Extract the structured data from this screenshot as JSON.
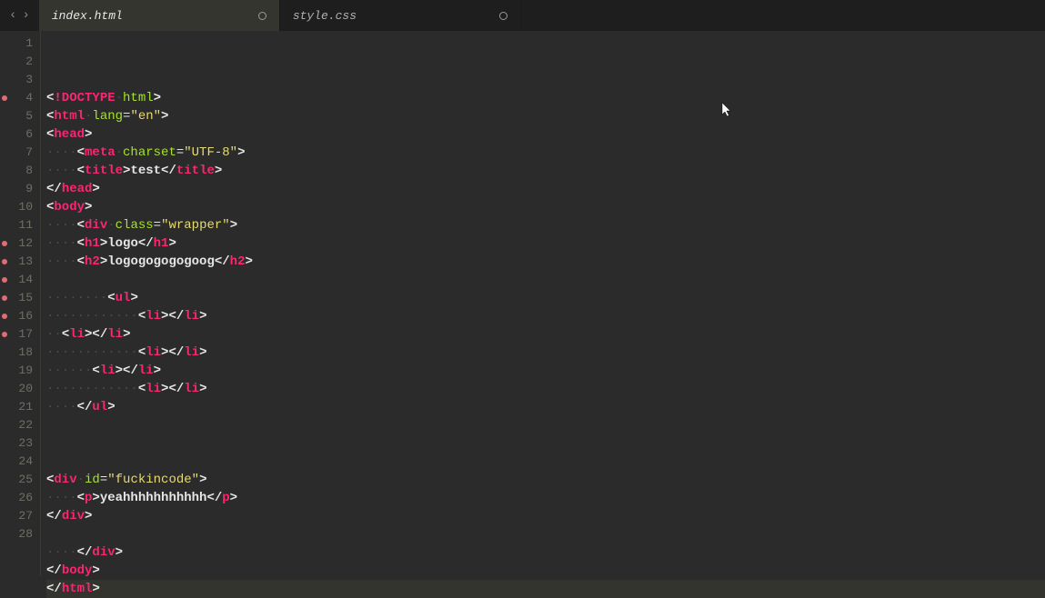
{
  "nav": {
    "back": "‹",
    "forward": "›"
  },
  "tabs": [
    {
      "name": "index.html",
      "active": true
    },
    {
      "name": "style.css",
      "active": false
    }
  ],
  "gutter": {
    "marks": [
      4,
      12,
      13,
      14,
      15,
      16,
      17
    ]
  },
  "code": [
    {
      "n": 1,
      "hl": false,
      "tokens": [
        [
          "punct",
          "<"
        ],
        [
          "doctype",
          "!DOCTYPE"
        ],
        [
          "ws",
          "·"
        ],
        [
          "attr",
          "html"
        ],
        [
          "punct",
          ">"
        ]
      ]
    },
    {
      "n": 2,
      "hl": false,
      "tokens": [
        [
          "punct",
          "<"
        ],
        [
          "tagname",
          "html"
        ],
        [
          "ws",
          "·"
        ],
        [
          "attr",
          "lang"
        ],
        [
          "op",
          "="
        ],
        [
          "str",
          "\"en\""
        ],
        [
          "punct",
          ">"
        ]
      ]
    },
    {
      "n": 3,
      "hl": false,
      "tokens": [
        [
          "punct",
          "<"
        ],
        [
          "tagname",
          "head"
        ],
        [
          "punct",
          ">"
        ]
      ]
    },
    {
      "n": 4,
      "hl": false,
      "tokens": [
        [
          "ws",
          "····"
        ],
        [
          "punct",
          "<"
        ],
        [
          "tagname",
          "meta"
        ],
        [
          "ws",
          "·"
        ],
        [
          "attr",
          "charset"
        ],
        [
          "op",
          "="
        ],
        [
          "str",
          "\"UTF-8\""
        ],
        [
          "punct",
          ">"
        ]
      ]
    },
    {
      "n": 5,
      "hl": false,
      "tokens": [
        [
          "ws",
          "····"
        ],
        [
          "punct",
          "<"
        ],
        [
          "tagname",
          "title"
        ],
        [
          "punct",
          ">"
        ],
        [
          "txt",
          "test"
        ],
        [
          "punct",
          "</"
        ],
        [
          "tagname",
          "title"
        ],
        [
          "punct",
          ">"
        ]
      ]
    },
    {
      "n": 6,
      "hl": false,
      "tokens": [
        [
          "punct",
          "</"
        ],
        [
          "tagname",
          "head"
        ],
        [
          "punct",
          ">"
        ]
      ]
    },
    {
      "n": 7,
      "hl": false,
      "tokens": [
        [
          "punct",
          "<"
        ],
        [
          "tagname",
          "body"
        ],
        [
          "punct",
          ">"
        ]
      ]
    },
    {
      "n": 8,
      "hl": false,
      "tokens": [
        [
          "ws",
          "····"
        ],
        [
          "punct",
          "<"
        ],
        [
          "tagname",
          "div"
        ],
        [
          "ws",
          "·"
        ],
        [
          "attr",
          "class"
        ],
        [
          "op",
          "="
        ],
        [
          "str",
          "\"wrapper\""
        ],
        [
          "punct",
          ">"
        ]
      ]
    },
    {
      "n": 9,
      "hl": false,
      "tokens": [
        [
          "ws",
          "····"
        ],
        [
          "punct",
          "<"
        ],
        [
          "tagname",
          "h1"
        ],
        [
          "punct",
          ">"
        ],
        [
          "txt",
          "logo"
        ],
        [
          "punct",
          "</"
        ],
        [
          "tagname",
          "h1"
        ],
        [
          "punct",
          ">"
        ]
      ]
    },
    {
      "n": 10,
      "hl": false,
      "tokens": [
        [
          "ws",
          "····"
        ],
        [
          "punct",
          "<"
        ],
        [
          "tagname",
          "h2"
        ],
        [
          "punct",
          ">"
        ],
        [
          "txt",
          "logogogogogoog"
        ],
        [
          "punct",
          "</"
        ],
        [
          "tagname",
          "h2"
        ],
        [
          "punct",
          ">"
        ]
      ]
    },
    {
      "n": 11,
      "hl": false,
      "tokens": []
    },
    {
      "n": 12,
      "hl": false,
      "tokens": [
        [
          "ws",
          "········"
        ],
        [
          "punct",
          "<"
        ],
        [
          "tagname",
          "ul"
        ],
        [
          "punct",
          ">"
        ]
      ]
    },
    {
      "n": 13,
      "hl": false,
      "tokens": [
        [
          "ws",
          "············"
        ],
        [
          "punct",
          "<"
        ],
        [
          "tagname",
          "li"
        ],
        [
          "punct",
          "></"
        ],
        [
          "tagname",
          "li"
        ],
        [
          "punct",
          ">"
        ]
      ]
    },
    {
      "n": 14,
      "hl": false,
      "tokens": [
        [
          "ws",
          "··"
        ],
        [
          "punct",
          "<"
        ],
        [
          "tagname",
          "li"
        ],
        [
          "punct",
          "></"
        ],
        [
          "tagname",
          "li"
        ],
        [
          "punct",
          ">"
        ]
      ]
    },
    {
      "n": 15,
      "hl": false,
      "tokens": [
        [
          "ws",
          "············"
        ],
        [
          "punct",
          "<"
        ],
        [
          "tagname",
          "li"
        ],
        [
          "punct",
          "></"
        ],
        [
          "tagname",
          "li"
        ],
        [
          "punct",
          ">"
        ]
      ]
    },
    {
      "n": 16,
      "hl": false,
      "tokens": [
        [
          "ws",
          "······"
        ],
        [
          "punct",
          "<"
        ],
        [
          "tagname",
          "li"
        ],
        [
          "punct",
          "></"
        ],
        [
          "tagname",
          "li"
        ],
        [
          "punct",
          ">"
        ]
      ]
    },
    {
      "n": 17,
      "hl": false,
      "tokens": [
        [
          "ws",
          "············"
        ],
        [
          "punct",
          "<"
        ],
        [
          "tagname",
          "li"
        ],
        [
          "punct",
          "></"
        ],
        [
          "tagname",
          "li"
        ],
        [
          "punct",
          ">"
        ]
      ]
    },
    {
      "n": 18,
      "hl": false,
      "tokens": [
        [
          "ws",
          "····"
        ],
        [
          "punct",
          "</"
        ],
        [
          "tagname",
          "ul"
        ],
        [
          "punct",
          ">"
        ]
      ]
    },
    {
      "n": 19,
      "hl": false,
      "tokens": []
    },
    {
      "n": 20,
      "hl": false,
      "tokens": []
    },
    {
      "n": 21,
      "hl": false,
      "tokens": []
    },
    {
      "n": 22,
      "hl": false,
      "tokens": [
        [
          "punct",
          "<"
        ],
        [
          "tagname",
          "div"
        ],
        [
          "ws",
          "·"
        ],
        [
          "attr",
          "id"
        ],
        [
          "op",
          "="
        ],
        [
          "str",
          "\"fuckincode\""
        ],
        [
          "punct",
          ">"
        ]
      ]
    },
    {
      "n": 23,
      "hl": false,
      "tokens": [
        [
          "ws",
          "····"
        ],
        [
          "punct",
          "<"
        ],
        [
          "tagname",
          "p"
        ],
        [
          "punct",
          ">"
        ],
        [
          "txt",
          "yeahhhhhhhhhhh"
        ],
        [
          "punct",
          "</"
        ],
        [
          "tagname",
          "p"
        ],
        [
          "punct",
          ">"
        ]
      ]
    },
    {
      "n": 24,
      "hl": false,
      "tokens": [
        [
          "punct",
          "</"
        ],
        [
          "tagname",
          "div"
        ],
        [
          "punct",
          ">"
        ]
      ]
    },
    {
      "n": 25,
      "hl": false,
      "tokens": []
    },
    {
      "n": 26,
      "hl": false,
      "tokens": [
        [
          "ws",
          "····"
        ],
        [
          "punct",
          "</"
        ],
        [
          "tagname",
          "div"
        ],
        [
          "punct",
          ">"
        ]
      ]
    },
    {
      "n": 27,
      "hl": false,
      "tokens": [
        [
          "punct",
          "</"
        ],
        [
          "tagname",
          "body"
        ],
        [
          "punct",
          ">"
        ]
      ]
    },
    {
      "n": 28,
      "hl": true,
      "tokens": [
        [
          "punct",
          "</"
        ],
        [
          "tagname",
          "html"
        ],
        [
          "punct",
          ">"
        ]
      ]
    }
  ]
}
